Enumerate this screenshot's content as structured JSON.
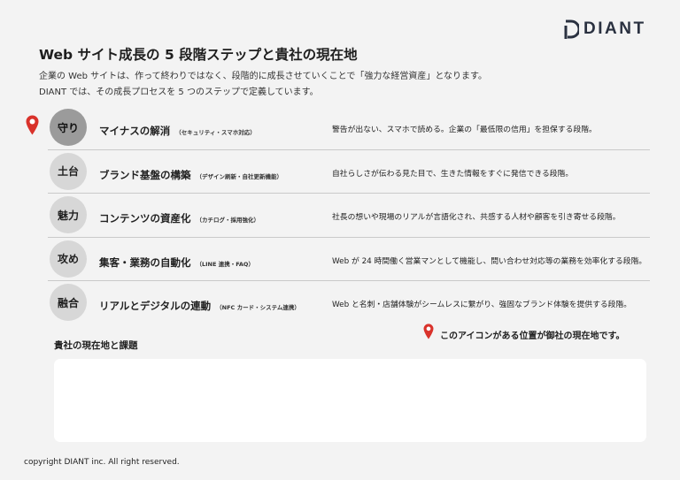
{
  "brand": {
    "logo_text": "DIANT",
    "logo_color": "#2a3140"
  },
  "header": {
    "title": "Web サイト成長の 5 段階ステップと貴社の現在地",
    "intro_line1": "企業の Web サイトは、作って終わりではなく、段階的に成長させていくことで「強力な経営資産」となります。",
    "intro_line2": "DIANT では、その成長プロセスを 5 つのステップで定義しています。"
  },
  "steps": [
    {
      "badge": "守り",
      "name": "マイナスの解消",
      "note": "（セキュリティ・スマホ対応）",
      "desc": "警告が出ない、スマホで読める。企業の「最低限の信用」を担保する段階。",
      "current": true
    },
    {
      "badge": "土台",
      "name": "ブランド基盤の構築",
      "note": "（デザイン刷新・自社更新機能）",
      "desc": "自社らしさが伝わる見た目で、生きた情報をすぐに発信できる段階。",
      "current": false
    },
    {
      "badge": "魅力",
      "name": "コンテンツの資産化",
      "note": "（カチログ・採用強化）",
      "desc": "社長の想いや現場のリアルが言語化され、共感する人材や顧客を引き寄せる段階。",
      "current": false
    },
    {
      "badge": "攻め",
      "name": "集客・業務の自動化",
      "note": "（LINE 連携・FAQ）",
      "desc": "Web が 24 時間働く営業マンとして機能し、問い合わせ対応等の業務を効率化する段階。",
      "current": false
    },
    {
      "badge": "融合",
      "name": "リアルとデジタルの連動",
      "note": "（NFC カード・システム連携）",
      "desc": "Web と名刺・店舗体験がシームレスに繋がり、強固なブランド体験を提供する段階。",
      "current": false
    }
  ],
  "legend": {
    "icon": "map-pin-icon",
    "text": "このアイコンがある位置が御社の現在地です。",
    "pin_color": "#d9322b"
  },
  "status": {
    "heading": "貴社の現在地と課題",
    "value": ""
  },
  "footer": {
    "copyright": "copyright DIANT inc. All right reserved."
  }
}
